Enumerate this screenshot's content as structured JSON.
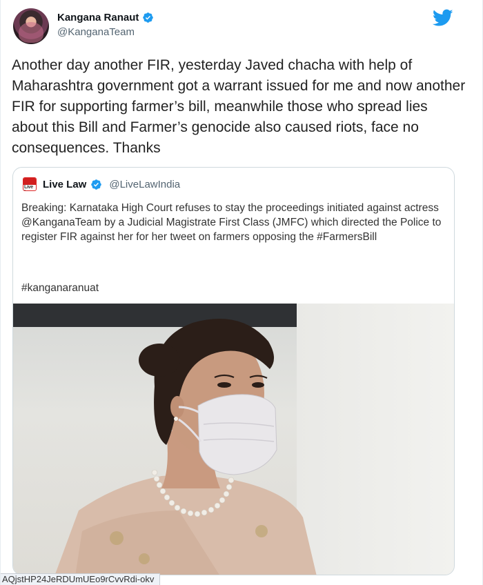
{
  "author": {
    "name": "Kangana Ranaut",
    "handle": "@KanganaTeam",
    "verified": true
  },
  "tweet": {
    "text": "Another day another FIR, yesterday Javed chacha with help of Maharashtra government got a warrant issued for me and now another FIR for supporting farmer’s bill, meanwhile those who spread lies about this Bill and Farmer’s genocide also caused riots, face no consequences. Thanks"
  },
  "quoted_tweet": {
    "name": "Live Law",
    "handle": "@LiveLawIndia",
    "logo_text": "Live Law",
    "verified": true,
    "text": "Breaking: Karnataka High Court refuses to stay the proceedings initiated against actress @KanganaTeam  by a Judicial Magistrate First Class (JMFC) which directed the Police  to register FIR against her for her tweet on farmers opposing the #FarmersBill",
    "hashtag": "#kanganaranuat"
  },
  "status_bar": {
    "url": "AQjstHP24JeRDUmUEo9rCvvRdi-okv"
  },
  "colors": {
    "accent": "#1d9bf0",
    "text": "#0f1419",
    "muted": "#536471",
    "border": "#cfd9de",
    "livelaw_red": "#d11f1f"
  },
  "icons": {
    "verified": "verified-badge-icon",
    "twitter": "twitter-bird-icon"
  }
}
